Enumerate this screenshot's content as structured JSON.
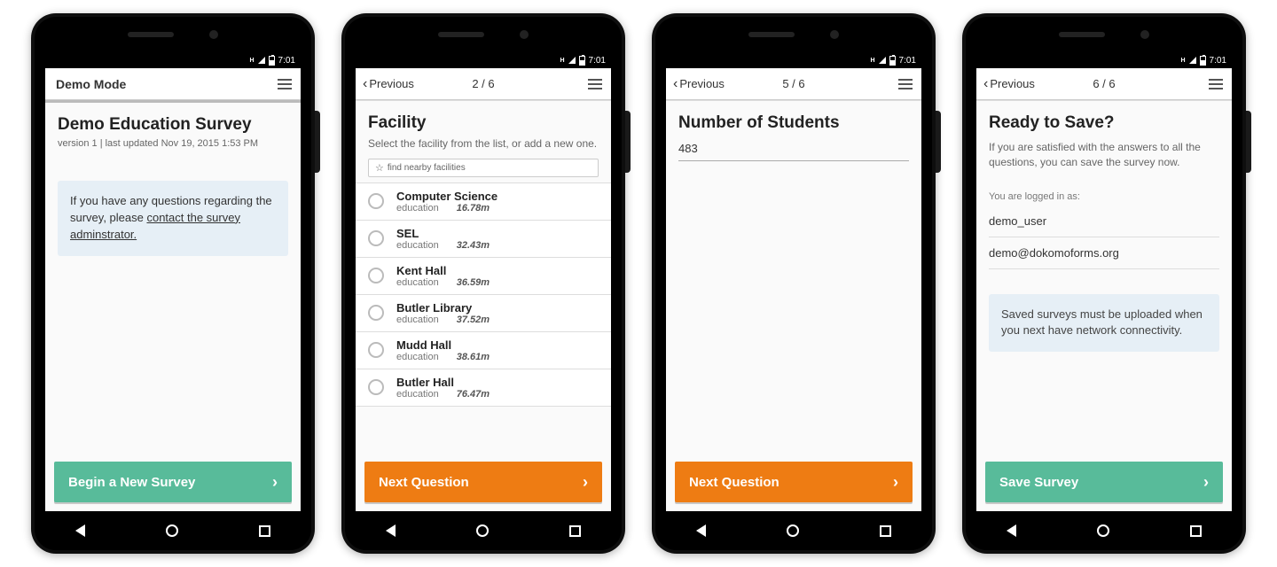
{
  "statusbar": {
    "network": "H",
    "time": "7:01"
  },
  "phone1": {
    "topbar_title": "Demo Mode",
    "title": "Demo Education Survey",
    "subtitle": "version 1 | last updated Nov 19, 2015 1:53 PM",
    "info_prefix": "If you have any questions regarding the survey, please ",
    "info_link": "contact the survey adminstrator.",
    "button": "Begin a New Survey"
  },
  "phone2": {
    "prev": "Previous",
    "progress": "2 / 6",
    "title": "Facility",
    "desc": "Select the facility from the list, or add a new one.",
    "find": "find nearby facilities",
    "facilities": [
      {
        "name": "Computer Science",
        "cat": "education",
        "dist": "16.78m"
      },
      {
        "name": "SEL",
        "cat": "education",
        "dist": "32.43m"
      },
      {
        "name": "Kent Hall",
        "cat": "education",
        "dist": "36.59m"
      },
      {
        "name": "Butler Library",
        "cat": "education",
        "dist": "37.52m"
      },
      {
        "name": "Mudd Hall",
        "cat": "education",
        "dist": "38.61m"
      },
      {
        "name": "Butler Hall",
        "cat": "education",
        "dist": "76.47m"
      }
    ],
    "button": "Next Question"
  },
  "phone3": {
    "prev": "Previous",
    "progress": "5 / 6",
    "title": "Number of Students",
    "value": "483",
    "button": "Next Question"
  },
  "phone4": {
    "prev": "Previous",
    "progress": "6 / 6",
    "title": "Ready to Save?",
    "desc": "If you are satisfied with the answers to all the questions, you can save the survey now.",
    "logged_label": "You are logged in as:",
    "username": "demo_user",
    "email": "demo@dokomoforms.org",
    "info": "Saved surveys must be uploaded when you next have network connectivity.",
    "button": "Save Survey"
  }
}
